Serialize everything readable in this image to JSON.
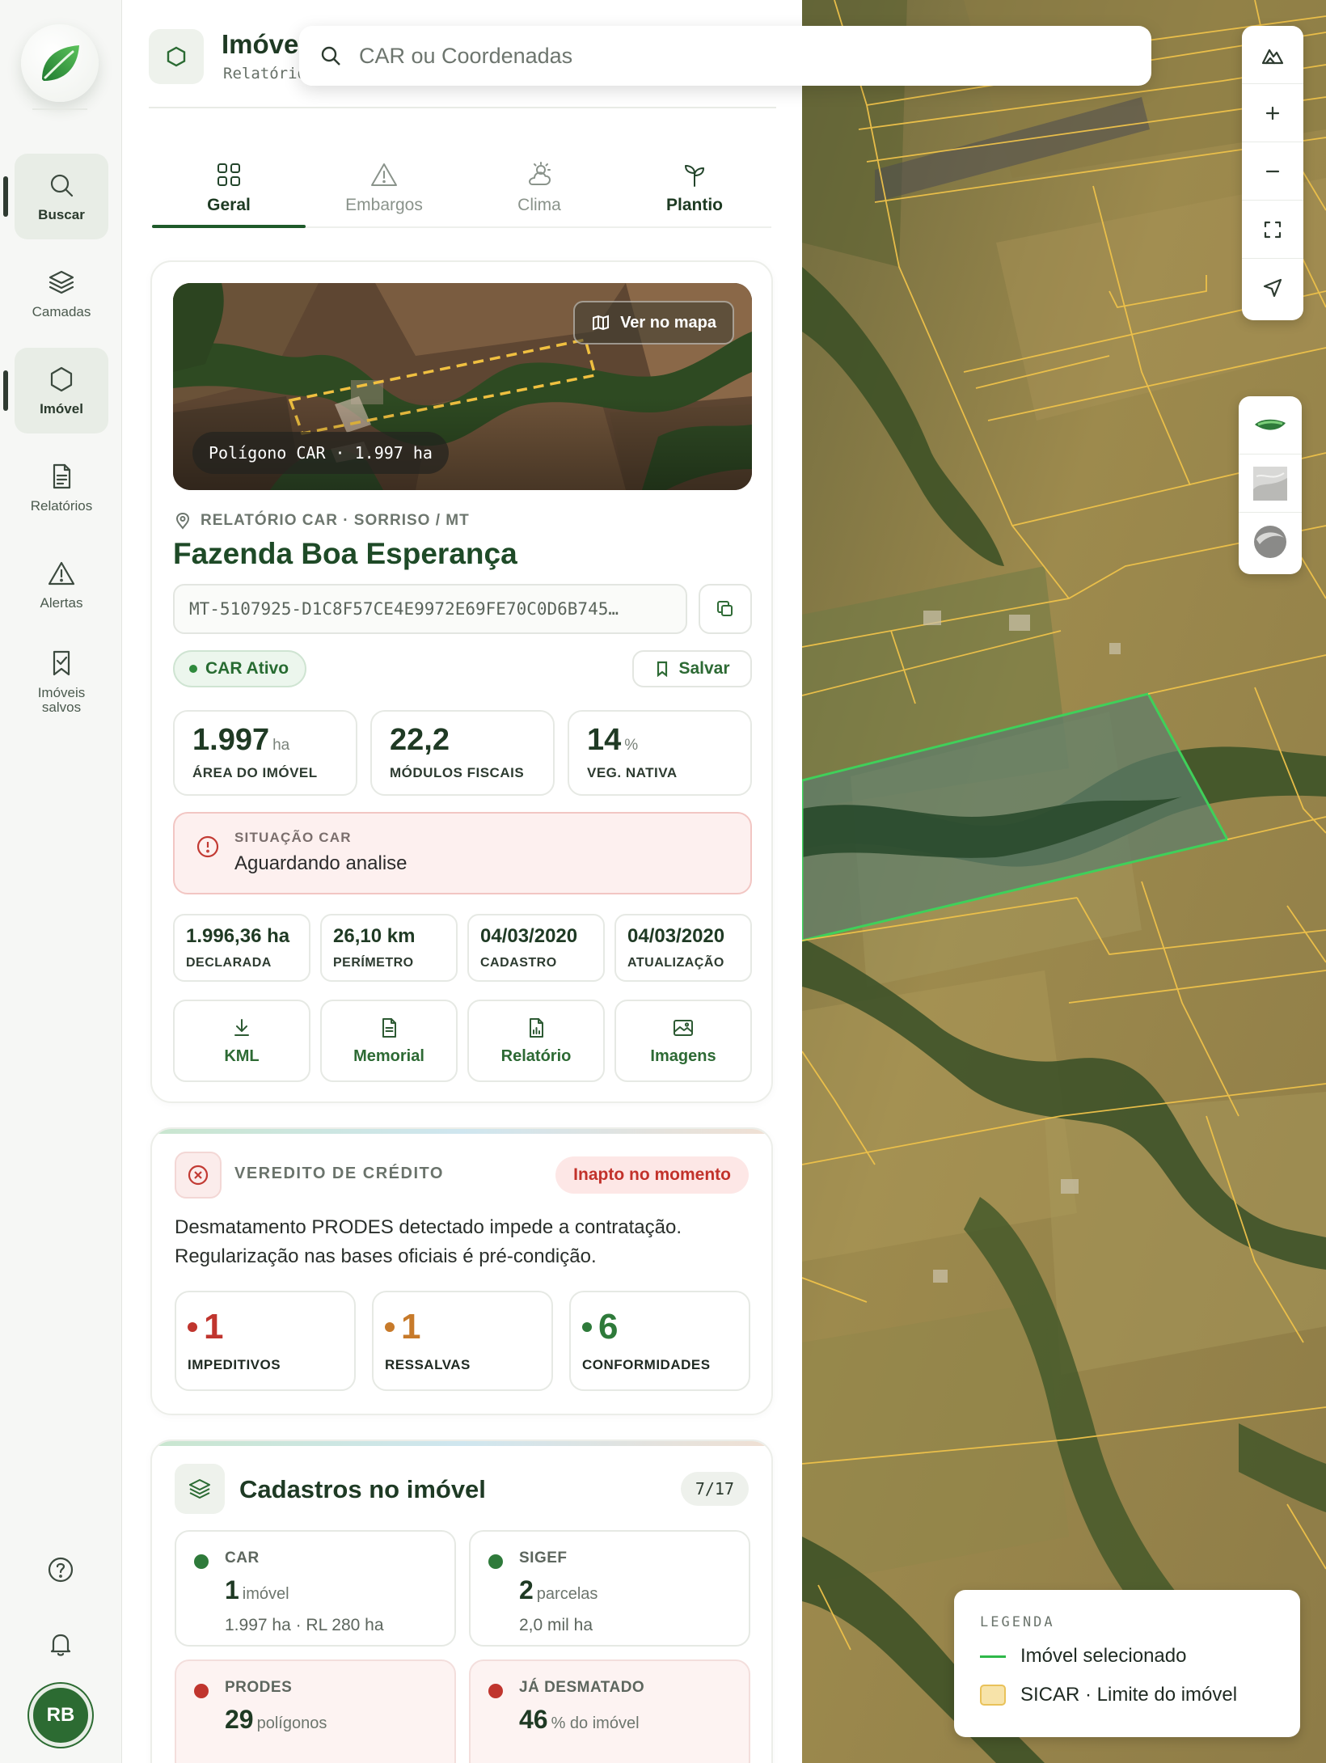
{
  "rail": {
    "items": [
      {
        "label": "Buscar",
        "icon": "search-icon"
      },
      {
        "label": "Camadas",
        "icon": "layers-icon"
      },
      {
        "label": "Imóvel",
        "icon": "hexagon-icon"
      },
      {
        "label": "Relatórios",
        "icon": "document-icon"
      },
      {
        "label": "Alertas",
        "icon": "warning-icon"
      },
      {
        "label": "Imóveis salvos",
        "icon": "bookmark-icon"
      }
    ],
    "avatar_initials": "RB"
  },
  "header": {
    "title": "Imóvel",
    "subtitle": "Relatório"
  },
  "search": {
    "placeholder": "CAR ou Coordenadas"
  },
  "tabs": [
    {
      "label": "Geral",
      "icon": "grid-icon",
      "active": true
    },
    {
      "label": "Embargos",
      "icon": "warning-icon"
    },
    {
      "label": "Clima",
      "icon": "weather-icon"
    },
    {
      "label": "Plantio",
      "icon": "sprout-icon"
    }
  ],
  "property": {
    "view_on_map": "Ver no mapa",
    "polygon_chip": "Polígono CAR · 1.997 ha",
    "location": "RELATÓRIO CAR · SORRISO / MT",
    "name": "Fazenda Boa Esperança",
    "car_code": "MT-5107925-D1C8F57CE4E9972E69FE70C0D6B745…",
    "status_badge": "CAR Ativo",
    "save_label": "Salvar",
    "stats": [
      {
        "value": "1.997",
        "unit": "ha",
        "label": "ÁREA DO IMÓVEL"
      },
      {
        "value": "22,2",
        "unit": "",
        "label": "MÓDULOS FISCAIS"
      },
      {
        "value": "14",
        "unit": "%",
        "label": "VEG. NATIVA"
      }
    ],
    "situation_label": "SITUAÇÃO CAR",
    "situation_value": "Aguardando analise",
    "details": [
      {
        "value": "1.996,36 ha",
        "label": "DECLARADA"
      },
      {
        "value": "26,10 km",
        "label": "PERÍMETRO"
      },
      {
        "value": "04/03/2020",
        "label": "CADASTRO"
      },
      {
        "value": "04/03/2020",
        "label": "ATUALIZAÇÃO"
      }
    ],
    "actions": [
      {
        "label": "KML",
        "icon": "download-icon"
      },
      {
        "label": "Memorial",
        "icon": "file-text-icon"
      },
      {
        "label": "Relatório",
        "icon": "file-chart-icon"
      },
      {
        "label": "Imagens",
        "icon": "image-icon"
      }
    ]
  },
  "verdict": {
    "label": "VEREDITO DE CRÉDITO",
    "badge": "Inapto no momento",
    "text": "Desmatamento PRODES detectado impede a contratação. Regularização nas bases oficiais é pré-condição.",
    "counts": [
      {
        "value": "1",
        "label": "IMPEDITIVOS",
        "color": "#c0352e"
      },
      {
        "value": "1",
        "label": "RESSALVAS",
        "color": "#c77a2a"
      },
      {
        "value": "6",
        "label": "CONFORMIDADES",
        "color": "#2e7a3a"
      }
    ]
  },
  "registries": {
    "title": "Cadastros no imóvel",
    "count": "7/17",
    "items": [
      {
        "key": "CAR",
        "value": "1",
        "unit": "imóvel",
        "sub": "1.997 ha · RL 280 ha",
        "color": "#2e7a3a",
        "alert": false
      },
      {
        "key": "SIGEF",
        "value": "2",
        "unit": "parcelas",
        "sub": "2,0 mil ha",
        "color": "#2e7a3a",
        "alert": false
      },
      {
        "key": "PRODES",
        "value": "29",
        "unit": "polígonos",
        "sub": "",
        "color": "#c0352e",
        "alert": true
      },
      {
        "key": "JÁ DESMATADO",
        "value": "46",
        "unit": "% do imóvel",
        "sub": "",
        "color": "#c0352e",
        "alert": true
      }
    ]
  },
  "map_controls": [
    "terrain-icon",
    "zoom-in-icon",
    "zoom-out-icon",
    "fullscreen-icon",
    "locate-icon"
  ],
  "legend": {
    "title": "LEGENDA",
    "items": [
      {
        "label": "Imóvel selecionado",
        "color": "#2fb84a"
      },
      {
        "label": "SICAR · Limite do imóvel",
        "color": "#e9c25a"
      }
    ]
  }
}
